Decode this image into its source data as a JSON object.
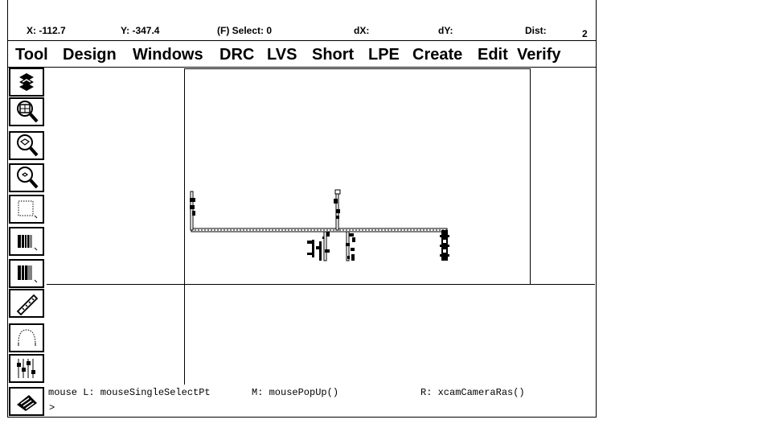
{
  "coords": {
    "x": "X: -112.7",
    "y": "Y: -347.4",
    "select": "(F) Select: 0",
    "dx": "dX:",
    "dy": "dY:",
    "dist": "Dist:",
    "window_number": "2"
  },
  "menu": [
    "Tool",
    "Design",
    "Windows",
    "DRC",
    "LVS",
    "Short",
    "LPE",
    "Create",
    "Edit",
    "Verify"
  ],
  "toolbar": [
    {
      "name": "redraw-icon"
    },
    {
      "name": "zoom-fit-icon"
    },
    {
      "name": "zoom-in-icon"
    },
    {
      "name": "zoom-out-icon"
    },
    {
      "name": "select-box-icon"
    },
    {
      "name": "layer-visible-icon"
    },
    {
      "name": "layer-select-icon"
    },
    {
      "name": "ruler-icon"
    },
    {
      "name": "arc-icon"
    },
    {
      "name": "stack-icon"
    },
    {
      "name": "properties-icon"
    }
  ],
  "status": {
    "mouse_left": "mouse L: mouseSingleSelectPt",
    "mouse_middle": "M: mousePopUp()",
    "mouse_right": "R: xcamCameraRas()",
    "prompt": ">"
  }
}
